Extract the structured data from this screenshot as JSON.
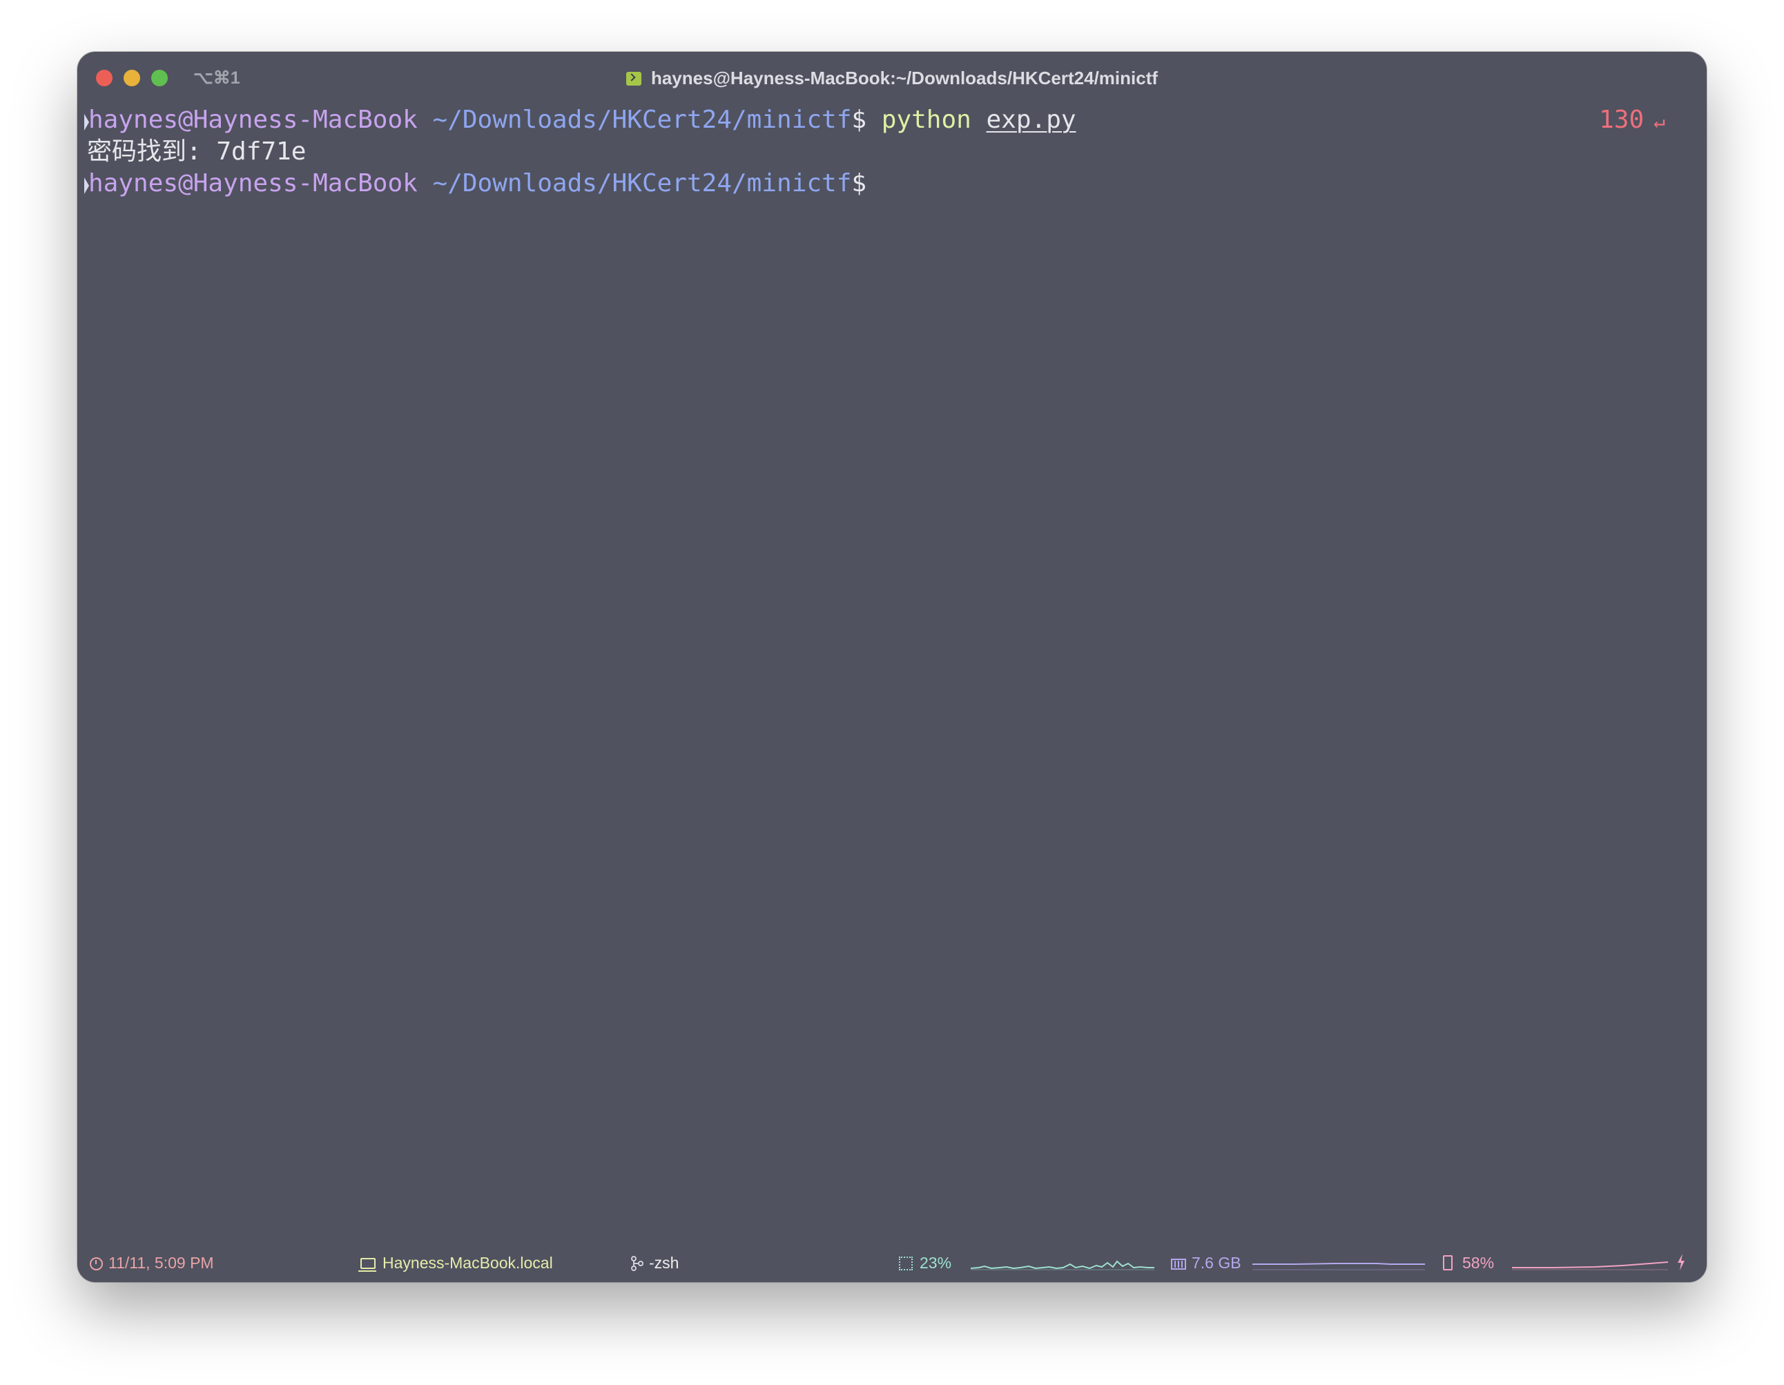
{
  "window": {
    "shortcut": "⌥⌘1",
    "title": "haynes@Hayness-MacBook:~/Downloads/HKCert24/minictf"
  },
  "terminal": {
    "lines": [
      {
        "user_host": "haynes@Hayness-MacBook",
        "path": "~/Downloads/HKCert24/minictf",
        "prompt_symbol": "$",
        "command": "python",
        "argument": "exp.py",
        "exit_code": "130",
        "exit_symbol": "↵"
      },
      {
        "output": "密码找到: 7df71e"
      },
      {
        "user_host": "haynes@Hayness-MacBook",
        "path": "~/Downloads/HKCert24/minictf",
        "prompt_symbol": "$"
      }
    ]
  },
  "statusbar": {
    "datetime": "11/11, 5:09 PM",
    "hostname": "Hayness-MacBook.local",
    "shell": "-zsh",
    "cpu": "23%",
    "memory": "7.6 GB",
    "battery": "58%",
    "icons": [
      "clock-icon",
      "laptop-icon",
      "branch-icon",
      "cpu-chip-icon",
      "memory-icon",
      "battery-icon",
      "charging-bolt-icon"
    ],
    "colors": {
      "datetime": "#e9a3a7",
      "hostname": "#e5ecab",
      "shell": "#eeeeee",
      "cpu": "#9ee1cf",
      "memory": "#b4a8ee",
      "battery": "#f2a3c2"
    }
  },
  "colors": {
    "background": "#50525f",
    "user": "#c8a3ee",
    "path": "#8fa6f0",
    "command": "#dff0a4",
    "exit_code": "#ef6f7b"
  }
}
